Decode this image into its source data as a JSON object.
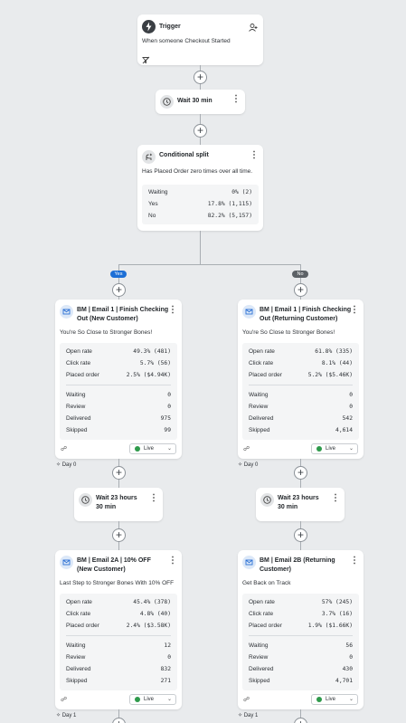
{
  "trigger": {
    "title": "Trigger",
    "description": "When someone Checkout Started"
  },
  "wait1": {
    "label": "Wait 30 min"
  },
  "split": {
    "title": "Conditional split",
    "description": "Has Placed Order zero times over all time.",
    "rows": [
      {
        "label": "Waiting",
        "value": "0% (2)"
      },
      {
        "label": "Yes",
        "value": "17.8% (1,115)"
      },
      {
        "label": "No",
        "value": "82.2% (5,157)"
      }
    ]
  },
  "branches": {
    "yes_label": "Yes",
    "no_label": "No"
  },
  "emails": [
    {
      "title_line1": "BM | Email 1 | Finish Checking",
      "title_line2": "Out (New Customer)",
      "subject": "You're So Close to Stronger Bones!",
      "metrics": [
        {
          "label": "Open rate",
          "value": "49.3% (481)"
        },
        {
          "label": "Click rate",
          "value": "5.7% (56)"
        },
        {
          "label": "Placed order",
          "value": "2.5% ($4.94K)"
        }
      ],
      "counts": [
        {
          "label": "Waiting",
          "value": "0"
        },
        {
          "label": "Review",
          "value": "0"
        },
        {
          "label": "Delivered",
          "value": "975"
        },
        {
          "label": "Skipped",
          "value": "99"
        }
      ],
      "status": "Live",
      "day": "Day 0"
    },
    {
      "title_line1": "BM | Email 1 | Finish Checking",
      "title_line2": "Out (Returning Customer)",
      "subject": "You're So Close to Stronger Bones!",
      "metrics": [
        {
          "label": "Open rate",
          "value": "61.8% (335)"
        },
        {
          "label": "Click rate",
          "value": "8.1% (44)"
        },
        {
          "label": "Placed order",
          "value": "5.2% ($5.46K)"
        }
      ],
      "counts": [
        {
          "label": "Waiting",
          "value": "0"
        },
        {
          "label": "Review",
          "value": "0"
        },
        {
          "label": "Delivered",
          "value": "542"
        },
        {
          "label": "Skipped",
          "value": "4,614"
        }
      ],
      "status": "Live",
      "day": "Day 0"
    },
    {
      "title_line1": "BM | Email 2A | 10% OFF",
      "title_line2": "(New Customer)",
      "subject": "Last Step to Stronger Bones With 10% OFF",
      "metrics": [
        {
          "label": "Open rate",
          "value": "45.4% (378)"
        },
        {
          "label": "Click rate",
          "value": "4.8% (40)"
        },
        {
          "label": "Placed order",
          "value": "2.4% ($3.58K)"
        }
      ],
      "counts": [
        {
          "label": "Waiting",
          "value": "12"
        },
        {
          "label": "Review",
          "value": "0"
        },
        {
          "label": "Delivered",
          "value": "832"
        },
        {
          "label": "Skipped",
          "value": "271"
        }
      ],
      "status": "Live",
      "day": "Day 1"
    },
    {
      "title_line1": "BM | Email 2B (Returning",
      "title_line2": "Customer)",
      "subject": "Get Back on Track",
      "metrics": [
        {
          "label": "Open rate",
          "value": "57% (245)"
        },
        {
          "label": "Click rate",
          "value": "3.7% (16)"
        },
        {
          "label": "Placed order",
          "value": "1.9% ($1.66K)"
        }
      ],
      "counts": [
        {
          "label": "Waiting",
          "value": "56"
        },
        {
          "label": "Review",
          "value": "0"
        },
        {
          "label": "Delivered",
          "value": "430"
        },
        {
          "label": "Skipped",
          "value": "4,701"
        }
      ],
      "status": "Live",
      "day": "Day 1"
    }
  ],
  "waits": [
    {
      "line1": "Wait 23 hours",
      "line2": "30 min"
    },
    {
      "line1": "Wait 23 hours",
      "line2": "30 min"
    }
  ],
  "colors": {
    "background": "#e9ebed",
    "yes_pill": "#1d6fd6",
    "no_pill": "#5c6166",
    "live_dot": "#2e9a4b",
    "email_icon": "#2a6fd3"
  },
  "icons": {
    "trigger": "lightning-icon",
    "trigger_action": "person-add-icon",
    "trigger_filter": "filter-off-icon",
    "wait": "clock-icon",
    "split": "split-icon",
    "email": "mail-icon",
    "settings": "link-icon",
    "day": "sparkle-icon",
    "more": "kebab-icon"
  }
}
